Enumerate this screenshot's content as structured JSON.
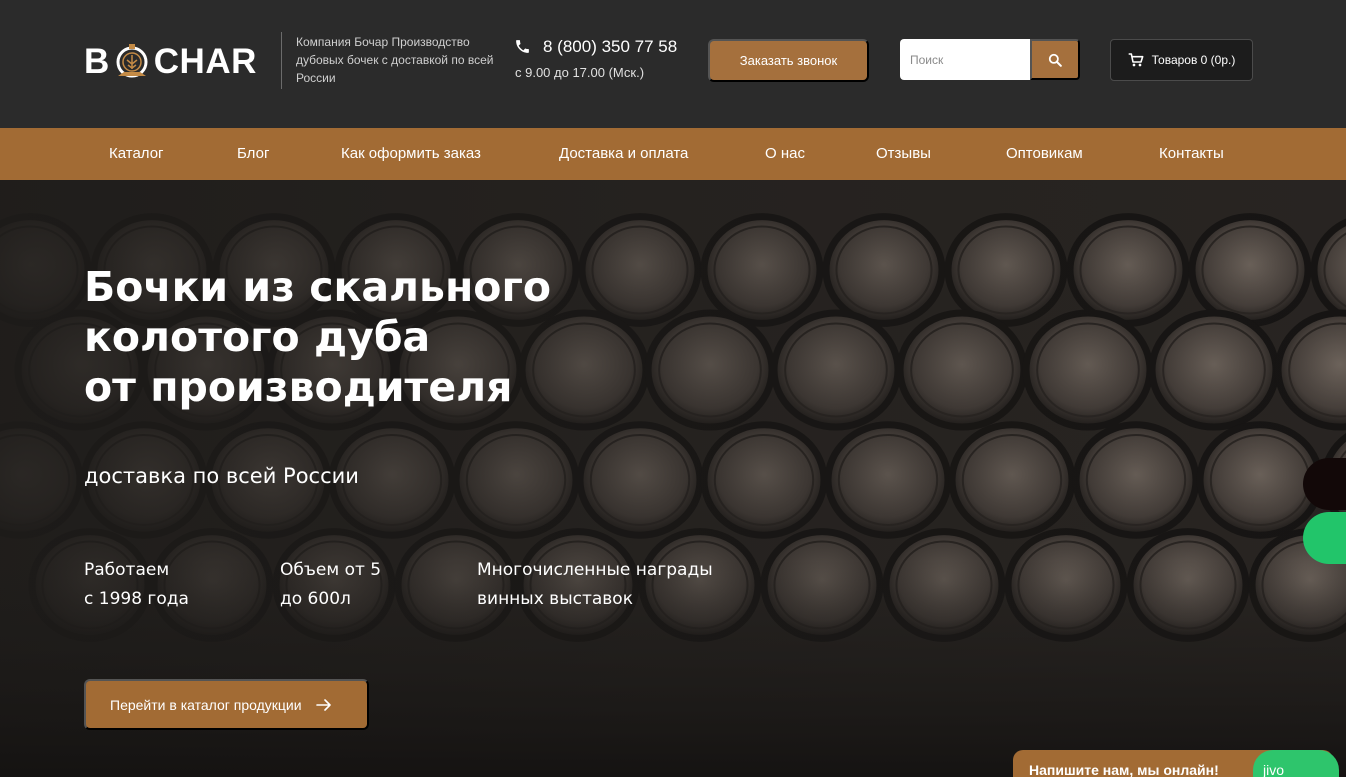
{
  "header": {
    "logo_text_left": "B",
    "logo_text_right": "CHAR",
    "tagline": "Компания Бочар Производство дубовых бочек с доставкой по всей России",
    "phone_number": "8 (800) 350 77 58",
    "phone_hours": "с 9.00 до 17.00 (Мск.)",
    "callback_label": "Заказать звонок",
    "search_placeholder": "Поиск",
    "cart_label": "Товаров 0 (0р.)"
  },
  "nav": {
    "items": [
      {
        "label": "Каталог"
      },
      {
        "label": "Блог"
      },
      {
        "label": "Как оформить заказ"
      },
      {
        "label": "Доставка и оплата"
      },
      {
        "label": "О нас"
      },
      {
        "label": "Отзывы"
      },
      {
        "label": "Оптовикам"
      },
      {
        "label": "Контакты"
      }
    ]
  },
  "hero": {
    "title_lines": [
      "Бочки из скального",
      "колотого дуба",
      "от производителя"
    ],
    "subtitle": "доставка по всей России",
    "features": [
      {
        "line1": "Работаем",
        "line2": "с 1998 года"
      },
      {
        "line1": "Объем от 5",
        "line2": "до 600л"
      },
      {
        "line1": "Многочисленные награды",
        "line2": "винных выставок"
      }
    ],
    "catalog_button": "Перейти в каталог продукции"
  },
  "chat": {
    "prompt": "Напишите нам, мы онлайн!",
    "brand": "jivo"
  },
  "colors": {
    "header_bg": "#2b2b2b",
    "accent": "#a26b34",
    "green": "#22c56a"
  },
  "icons": [
    "phone-icon",
    "search-icon",
    "cart-icon",
    "arrow-right-icon",
    "barrel-logo-icon"
  ]
}
